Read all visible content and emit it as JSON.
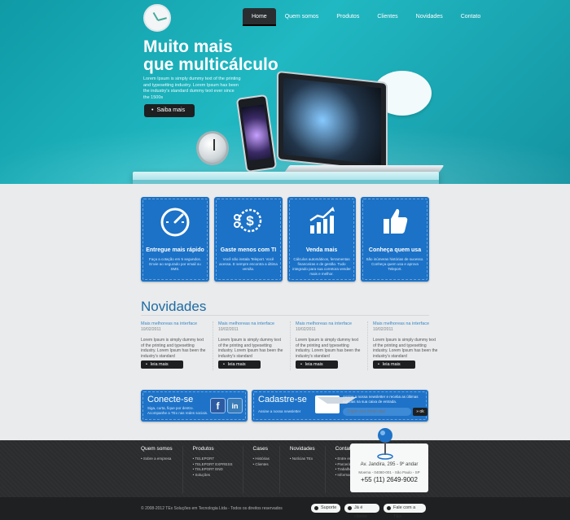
{
  "nav": {
    "items": [
      "Home",
      "Quem somos",
      "Produtos",
      "Clientes",
      "Novidades",
      "Contato"
    ],
    "active": "Home"
  },
  "hero": {
    "title_line1": "Muito mais",
    "title_line2": "que multicálculo",
    "text": "Lorem Ipsum is simply dummy text of the printing and typesetting industry. Lorem Ipsum has been the industry's standard dummy text ever since the 1500s",
    "button": "Saiba mais"
  },
  "features": [
    {
      "icon": "speedometer-icon",
      "title": "Entregue mais rápido",
      "text": "Faça a cotação em 5 segundos. Envie ao segurado por email ou SMS."
    },
    {
      "icon": "scissors-dollar-icon",
      "title": "Gaste menos com TI",
      "text": "Você não instala Teleport. Você acessa. E sempre encontra a última versão."
    },
    {
      "icon": "growth-chart-icon",
      "title": "Venda mais",
      "text": "Cálculos automáticos, ferramentas financeiras e de gestão. Tudo integrado para sua corretora vender mais e melhor."
    },
    {
      "icon": "thumbs-up-icon",
      "title": "Conheça quem usa",
      "text": "São inúmeras histórias de sucesso. Conheça quem usa e aprova Teleport."
    }
  ],
  "news": {
    "title": "Novidades",
    "items": [
      {
        "title": "Mais melhoreas na interface",
        "date": "10/02/2011",
        "text": "Lorem Ipsum is simply dummy text of the printing and typesetting industry. Lorem Ipsum has been the industry's standard",
        "more": "leia mais"
      },
      {
        "title": "Mais melhoreas na interface",
        "date": "10/02/2011",
        "text": "Lorem Ipsum is simply dummy text of the printing and typesetting industry. Lorem Ipsum has been the industry's standard",
        "more": "leia mais"
      },
      {
        "title": "Mais melhoreas na interface",
        "date": "10/02/2011",
        "text": "Lorem Ipsum is simply dummy text of the printing and typesetting industry. Lorem Ipsum has been the industry's standard",
        "more": "leia mais"
      },
      {
        "title": "Mais melhoreas na interface",
        "date": "10/02/2011",
        "text": "Lorem Ipsum is simply dummy text of the printing and typesetting industry. Lorem Ipsum has been the industry's standard",
        "more": "leia mais"
      }
    ]
  },
  "connect": {
    "title": "Conecte-se",
    "sub": "Siga, curta, fique por dentro. Acompanhe a TEx nas redes sociais.",
    "facebook": "f",
    "linkedin": "in"
  },
  "signup": {
    "title": "Cadastre-se",
    "sub": "Assine a nossa newsletter",
    "text": "Assine a nossa newsletter e receba as últimas notícias na sua caixa de entrada.",
    "placeholder": "Digite seu email aqui",
    "ok": "» ok"
  },
  "footer": {
    "cols": [
      {
        "title": "Quem somos",
        "items": [
          "Sobre a empresa"
        ]
      },
      {
        "title": "Produtos",
        "items": [
          "TELEPORT",
          "TELEPORT EXPRESS",
          "TELEPORT END",
          "Soluções"
        ]
      },
      {
        "title": "Cases",
        "items": [
          "Histórias",
          "Clientes"
        ]
      },
      {
        "title": "Novidades",
        "items": [
          "Notícias TEx"
        ]
      },
      {
        "title": "Contato",
        "items": [
          "Entre em contato",
          "Parcerias",
          "Trabalhe conosco",
          "Informações sobre suporte"
        ]
      }
    ],
    "address_line1": "Av. Jandira, 295 - 9º andar",
    "address_line2": "Moema - 04080-001 - São Paulo - SP",
    "phone": "+55 (11) 2649-9002"
  },
  "bottom": {
    "copyright": "© 2008-2012 TEx Soluções em Tecnologia Ltda - Todos os direitos reservados",
    "buttons": [
      "Suporte",
      "Já é cliente",
      "Fale com a TEx"
    ]
  },
  "colors": {
    "hero": "#20b8c2",
    "card_blue": "#1b72c7",
    "news_title": "#1e6aa3",
    "footer": "#2b2c2d"
  }
}
